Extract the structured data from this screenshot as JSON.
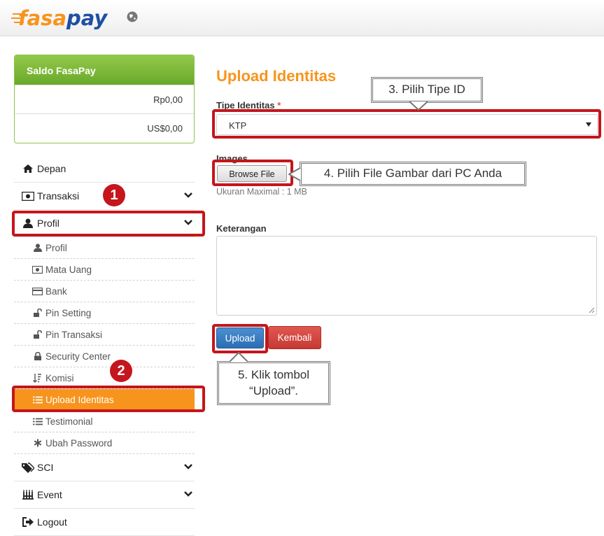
{
  "header": {
    "logo_text": "fasapay",
    "language_icon": "globe-icon"
  },
  "saldo": {
    "title": "Saldo FasaPay",
    "idr": "Rp0,00",
    "usd": "US$0,00"
  },
  "sidebar": {
    "items": [
      {
        "label": "Depan",
        "icon": "home-icon"
      },
      {
        "label": "Transaksi",
        "icon": "money-icon"
      },
      {
        "label": "Profil",
        "icon": "user-icon"
      },
      {
        "label": "SCI",
        "icon": "tags-icon"
      },
      {
        "label": "Event",
        "icon": "event-icon"
      },
      {
        "label": "Logout",
        "icon": "logout-icon"
      }
    ],
    "profil_sub": [
      {
        "label": "Profil",
        "icon": "user-icon"
      },
      {
        "label": "Mata Uang",
        "icon": "money-icon"
      },
      {
        "label": "Bank",
        "icon": "credit-card-icon"
      },
      {
        "label": "Pin Setting",
        "icon": "unlock-icon"
      },
      {
        "label": "Pin Transaksi",
        "icon": "unlock-icon"
      },
      {
        "label": "Security Center",
        "icon": "lock-icon"
      },
      {
        "label": "Komisi",
        "icon": "sort-icon"
      },
      {
        "label": "Upload Identitas",
        "icon": "list-icon"
      },
      {
        "label": "Testimonial",
        "icon": "list-icon"
      },
      {
        "label": "Ubah Password",
        "icon": "asterisk-icon"
      }
    ]
  },
  "main": {
    "title": "Upload Identitas",
    "tipe_label": "Tipe Identitas",
    "required_mark": "*",
    "tipe_value": "KTP",
    "images_label": "Images",
    "browse_label": "Browse File",
    "max_hint": "Ukuran Maximal : 1 MB",
    "keterangan_label": "Keterangan",
    "upload_button": "Upload",
    "back_button": "Kembali"
  },
  "annotations": {
    "step1": "1",
    "step2": "2",
    "callout3": "3. Pilih Tipe ID",
    "callout4": "4. Pilih File Gambar dari PC Anda",
    "callout5_line1": "5. Klik tombol",
    "callout5_line2": "“Upload”.",
    "highlight_color": "#c4161c"
  },
  "colors": {
    "accent": "#f7941d",
    "saldo_green": "#7ab637",
    "primary_blue": "#2a6db3",
    "danger_red": "#c63a33"
  }
}
